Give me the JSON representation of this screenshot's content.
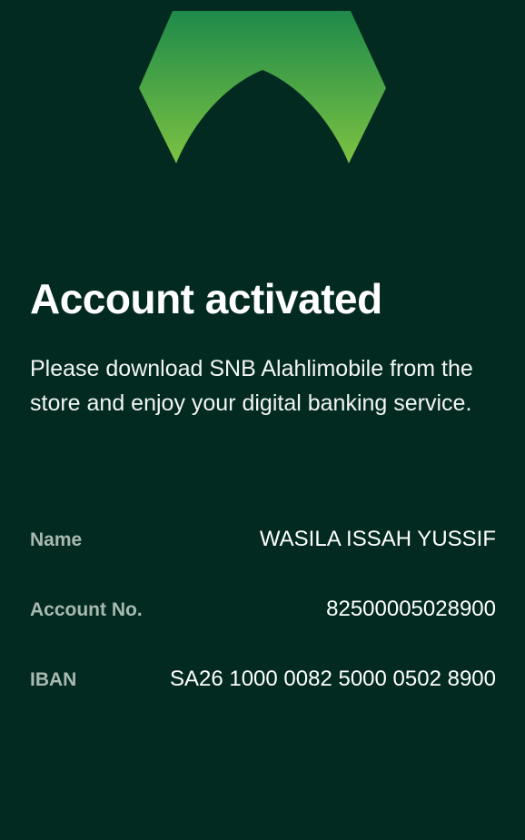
{
  "logo": {
    "icon": "snb-logo-icon",
    "gradient_top": "#1e8a4a",
    "gradient_bottom": "#7cc242"
  },
  "title": "Account activated",
  "message": "Please download SNB Alahlimobile from the store and enjoy your digital banking service.",
  "details": [
    {
      "label": "Name",
      "value": "WASILA ISSAH YUSSIF"
    },
    {
      "label": "Account No.",
      "value": "82500005028900"
    },
    {
      "label": "IBAN",
      "value": "SA26 1000 0082 5000 0502 8900"
    }
  ],
  "colors": {
    "background": "#022a20",
    "label": "#a9b9b1",
    "text": "#ffffff"
  }
}
